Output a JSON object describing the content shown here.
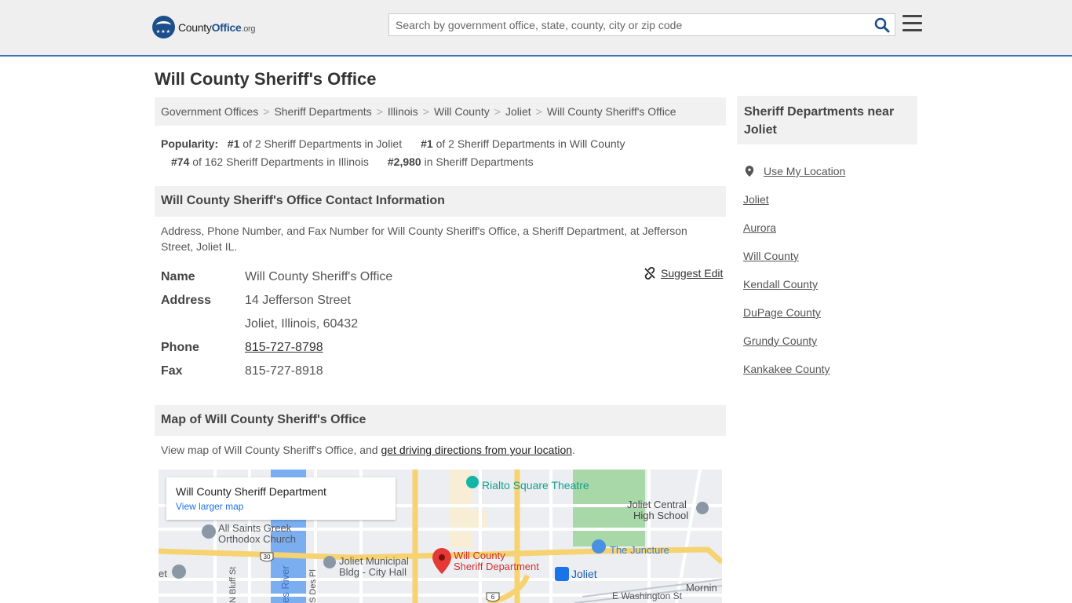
{
  "header": {
    "logo_main": "County",
    "logo_bold": "Office",
    "logo_tld": ".org",
    "search_placeholder": "Search by government office, state, county, city or zip code"
  },
  "page": {
    "title": "Will County Sheriff's Office"
  },
  "breadcrumb": [
    "Government Offices",
    "Sheriff Departments",
    "Illinois",
    "Will County",
    "Joliet",
    "Will County Sheriff's Office"
  ],
  "popularity": {
    "label": "Popularity:",
    "items": [
      {
        "rank": "#1",
        "text": "of 2 Sheriff Departments in Joliet"
      },
      {
        "rank": "#1",
        "text": "of 2 Sheriff Departments in Will County"
      },
      {
        "rank": "#74",
        "text": "of 162 Sheriff Departments in Illinois"
      },
      {
        "rank": "#2,980",
        "text": "in Sheriff Departments"
      }
    ]
  },
  "contact": {
    "heading": "Will County Sheriff's Office Contact Information",
    "description": "Address, Phone Number, and Fax Number for Will County Sheriff's Office, a Sheriff Department, at Jefferson Street, Joliet IL.",
    "suggest_edit": "Suggest Edit",
    "rows": {
      "name_label": "Name",
      "name_value": "Will County Sheriff's Office",
      "address_label": "Address",
      "address_line1": "14 Jefferson Street",
      "address_line2": "Joliet, Illinois, 60432",
      "phone_label": "Phone",
      "phone_value": "815-727-8798",
      "fax_label": "Fax",
      "fax_value": "815-727-8918"
    }
  },
  "map_section": {
    "heading": "Map of Will County Sheriff's Office",
    "desc_prefix": "View map of Will County Sheriff's Office, and ",
    "desc_link": "get driving directions from your location",
    "desc_suffix": ".",
    "card_title": "Will County Sheriff Department",
    "card_link": "View larger map",
    "labels": {
      "rialto": "Rialto Square Theatre",
      "jchs1": "Joliet Central",
      "jchs2": "High School",
      "allsaints1": "All Saints Greek",
      "allsaints2": "Orthodox Church",
      "municipal1": "Joliet Municipal",
      "municipal2": "Bldg - City Hall",
      "wcsd1": "Will County",
      "wcsd2": "Sheriff Department",
      "juncture": "The Juncture",
      "joliet": "Joliet",
      "morning": "Mornin",
      "washington": "E Washington St",
      "river": "es River",
      "bluff": "N Bluff St",
      "desplaines": "S Des Pl",
      "et": "et",
      "route30": "30",
      "route6": "6"
    }
  },
  "sidebar": {
    "heading": "Sheriff Departments near Joliet",
    "use_location": "Use My Location",
    "links": [
      "Joliet",
      "Aurora",
      "Will County",
      "Kendall County",
      "DuPage County",
      "Grundy County",
      "Kankakee County"
    ]
  }
}
